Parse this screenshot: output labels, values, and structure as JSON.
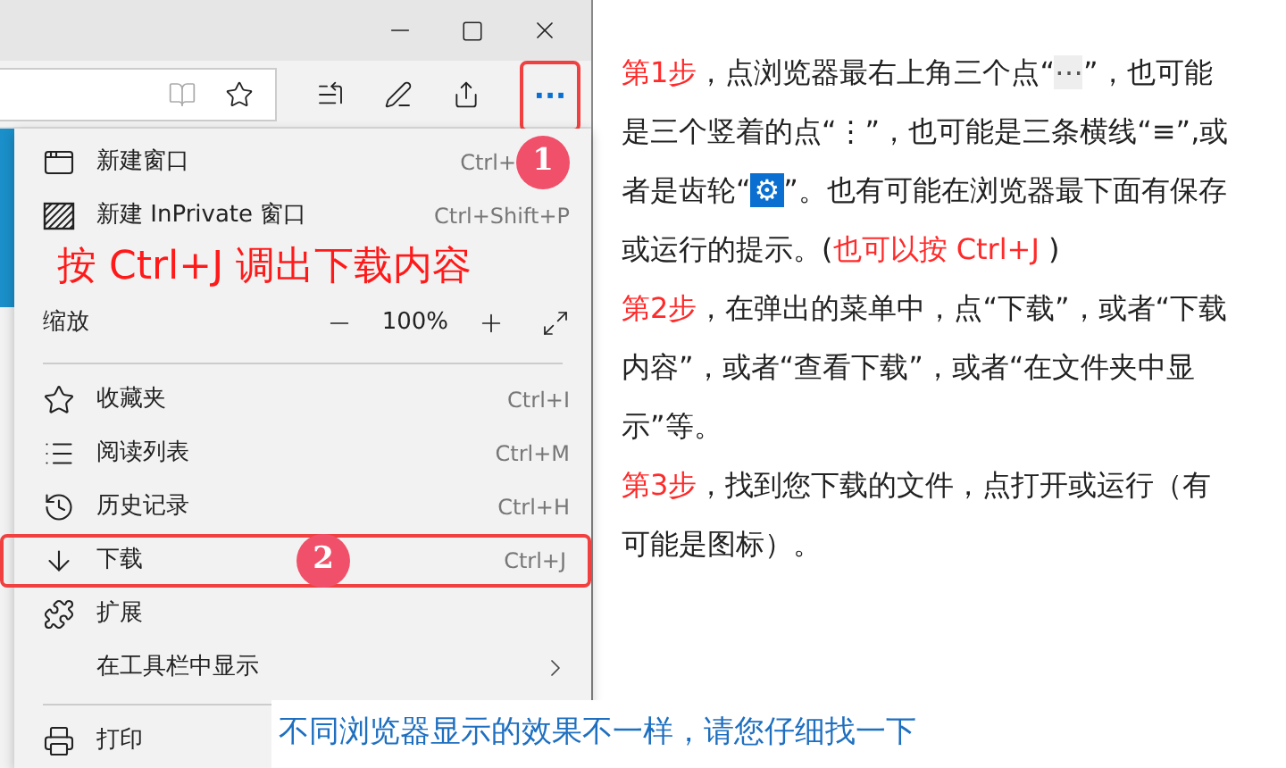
{
  "more_button": {
    "label": "···",
    "highlighted": true
  },
  "menu": {
    "items": [
      {
        "kind": "item",
        "label": "新建窗口",
        "shortcut": "Ctrl+",
        "badge": "1",
        "highlighted": false
      },
      {
        "kind": "item",
        "label": "新建 InPrivate 窗口",
        "shortcut": "Ctrl+Shift+P",
        "highlighted": false
      },
      {
        "kind": "note",
        "label": "按 Ctrl+J 调出下载内容"
      },
      {
        "kind": "zoom",
        "label": "缩放",
        "value": "100%"
      },
      {
        "kind": "divider"
      },
      {
        "kind": "item",
        "label": "收藏夹",
        "shortcut": "Ctrl+I",
        "highlighted": false
      },
      {
        "kind": "item",
        "label": "阅读列表",
        "shortcut": "Ctrl+M",
        "highlighted": false
      },
      {
        "kind": "item",
        "label": "历史记录",
        "shortcut": "Ctrl+H",
        "highlighted": false
      },
      {
        "kind": "item",
        "label": "下载",
        "shortcut": "Ctrl+J",
        "badge": "2",
        "highlighted": true
      },
      {
        "kind": "item",
        "label": "扩展",
        "highlighted": false
      },
      {
        "kind": "submenu",
        "label": "在工具栏中显示"
      },
      {
        "kind": "divider"
      },
      {
        "kind": "item",
        "label": "打印",
        "highlighted": false
      }
    ]
  },
  "steps": [
    {
      "segments": [
        {
          "kind": "red",
          "text": "第1步"
        },
        {
          "kind": "plain",
          "text": "，点浏览器最右上角三个点“"
        },
        {
          "kind": "boxed",
          "text": "⋯"
        },
        {
          "kind": "plain",
          "text": "”，也可能是三个竖着的点“⋮”，也可能是三条横线“≡”,或者是齿轮“"
        },
        {
          "kind": "gear",
          "text": "⚙"
        },
        {
          "kind": "plain",
          "text": "”。也有可能在浏览器最下面有保存或运行的提示。("
        },
        {
          "kind": "red",
          "text": "也可以按 Ctrl+J"
        },
        {
          "kind": "plain",
          "text": " )"
        }
      ]
    },
    {
      "segments": [
        {
          "kind": "red",
          "text": "第2步"
        },
        {
          "kind": "plain",
          "text": "，在弹出的菜单中，点“下载”，或者“下载内容”，或者“查看下载”，或者“在文件夹中显示”等。"
        }
      ]
    },
    {
      "segments": [
        {
          "kind": "red",
          "text": "第3步"
        },
        {
          "kind": "plain",
          "text": "，找到您下载的文件，点打开或运行（有可能是图标）。"
        }
      ]
    }
  ],
  "footer_note": "不同浏览器显示的效果不一样，请您仔细找一下"
}
